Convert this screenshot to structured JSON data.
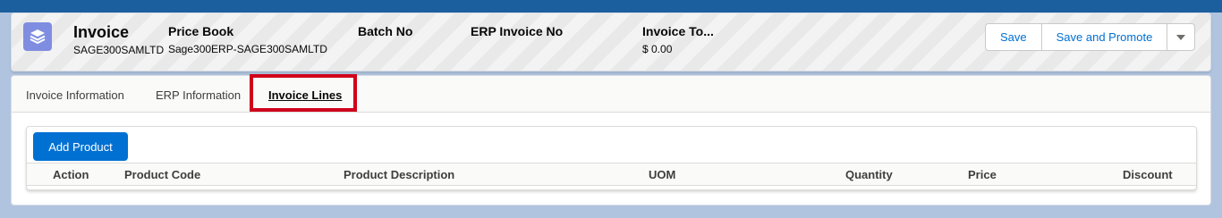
{
  "record": {
    "title": "Invoice",
    "subtitle": "SAGE300SAMLTD",
    "icon": "layers-icon",
    "fields": [
      {
        "label": "Price Book",
        "value": "Sage300ERP-SAGE300SAMLTD"
      },
      {
        "label": "Batch No",
        "value": ""
      },
      {
        "label": "ERP Invoice No",
        "value": ""
      },
      {
        "label": "Invoice To...",
        "value": "$ 0.00"
      }
    ]
  },
  "actions": {
    "save": "Save",
    "save_promote": "Save and Promote",
    "more_icon": "chevron-down-icon"
  },
  "tabs": [
    {
      "label": "Invoice Information",
      "active": false
    },
    {
      "label": "ERP Information",
      "active": false
    },
    {
      "label": "Invoice Lines",
      "active": true
    }
  ],
  "lines": {
    "add_button": "Add Product",
    "columns": [
      "Action",
      "Product Code",
      "Product Description",
      "UOM",
      "Quantity",
      "Price",
      "Discount"
    ]
  },
  "colors": {
    "brand": "#0070d2",
    "highlight": "#d0021b",
    "icon_bg": "#7f8de1"
  }
}
